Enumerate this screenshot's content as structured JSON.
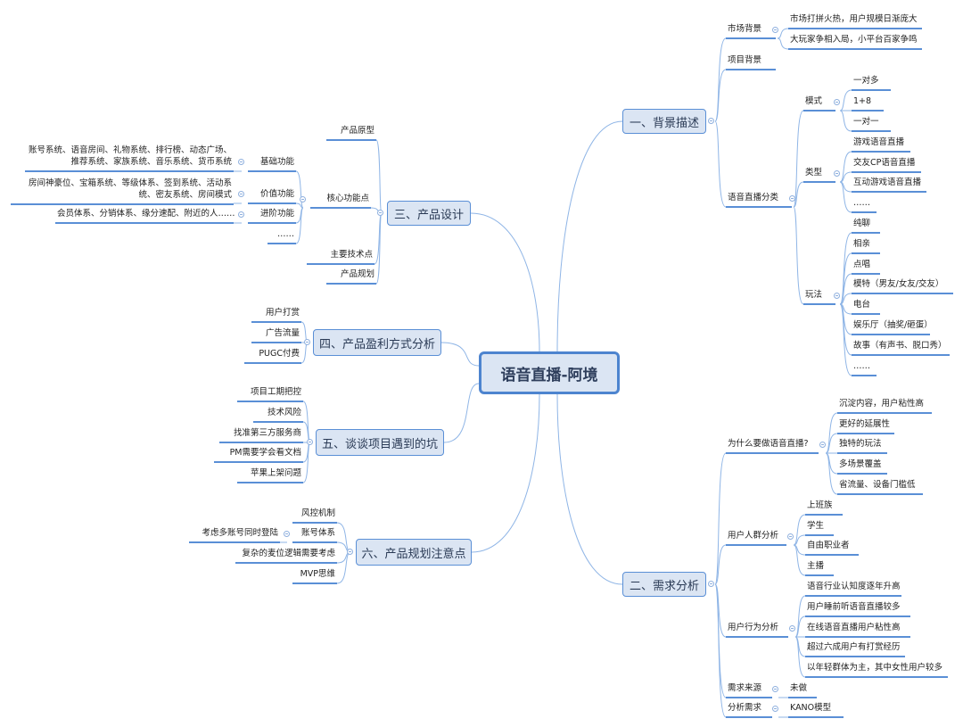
{
  "root": {
    "label": "语音直播-阿境"
  },
  "branches": {
    "b1": {
      "label": "一、背景描述",
      "market_bg": {
        "label": "市场背景",
        "children": [
          "市场打拼火热，用户规模日渐庞大",
          "大玩家争相入局，小平台百家争鸣"
        ]
      },
      "project_bg": {
        "label": "项目背景"
      },
      "classification": {
        "label": "语音直播分类",
        "mode": {
          "label": "模式",
          "children": [
            "一对多",
            "1+8",
            "一对一"
          ]
        },
        "type": {
          "label": "类型",
          "children": [
            "游戏语音直播",
            "交友CP语音直播",
            "互动游戏语音直播",
            "……"
          ]
        },
        "play": {
          "label": "玩法",
          "children": [
            "纯聊",
            "相亲",
            "点唱",
            "模特（男友/女友/交友）",
            "电台",
            "娱乐厅（抽奖/砸蛋）",
            "故事（有声书、脱口秀）",
            "……"
          ]
        }
      }
    },
    "b2": {
      "label": "二、需求分析",
      "why": {
        "label": "为什么要做语音直播?",
        "children": [
          "沉淀内容，用户粘性高",
          "更好的延展性",
          "独特的玩法",
          "多场景覆盖",
          "省流量、设备门槛低"
        ]
      },
      "users": {
        "label": "用户人群分析",
        "children": [
          "上班族",
          "学生",
          "自由职业者",
          "主播"
        ]
      },
      "behavior": {
        "label": "用户行为分析",
        "children": [
          "语音行业认知度逐年升高",
          "用户睡前听语音直播较多",
          "在线语音直播用户粘性高",
          "超过六成用户有打赏经历",
          "以年轻群体为主，其中女性用户较多"
        ]
      },
      "source": {
        "label": "需求来源",
        "children": [
          "未做"
        ]
      },
      "analysis": {
        "label": "分析需求",
        "children": [
          "KANO模型"
        ]
      }
    },
    "b3": {
      "label": "三、产品设计",
      "prototype": {
        "label": "产品原型"
      },
      "core": {
        "label": "核心功能点",
        "basic": {
          "label": "基础功能",
          "detail": "账号系统、语音房间、礼物系统、排行榜、动态广场、推荐系统、家族系统、音乐系统、货币系统"
        },
        "value": {
          "label": "价值功能",
          "detail": "房间神豪位、宝箱系统、等级体系、签到系统、活动系统、密友系统、房间模式"
        },
        "advanced": {
          "label": "进阶功能",
          "detail": "会员体系、分销体系、缘分速配、附近的人……"
        },
        "more": {
          "label": "……"
        }
      },
      "tech": {
        "label": "主要技术点"
      },
      "plan": {
        "label": "产品规划"
      }
    },
    "b4": {
      "label": "四、产品盈利方式分析",
      "children": [
        "用户打赏",
        "广告流量",
        "PUGC付费"
      ]
    },
    "b5": {
      "label": "五、谈谈项目遇到的坑",
      "children": [
        "项目工期把控",
        "技术风险",
        "找准第三方服务商",
        "PM需要学会看文档",
        "苹果上架问题"
      ]
    },
    "b6": {
      "label": "六、产品规划注意点",
      "risk": {
        "label": "风控机制"
      },
      "account": {
        "label": "账号体系",
        "detail": "考虑多账号同时登陆"
      },
      "mic": {
        "label": "复杂的麦位逻辑需要考虑"
      },
      "mvp": {
        "label": "MVP思维"
      }
    }
  },
  "colors": {
    "line": "#8fb5e6",
    "underline": "#5a8fd6",
    "node_fill": "#dbe5f3",
    "node_border": "#5a8fd6",
    "root_border": "#4d84cf"
  }
}
